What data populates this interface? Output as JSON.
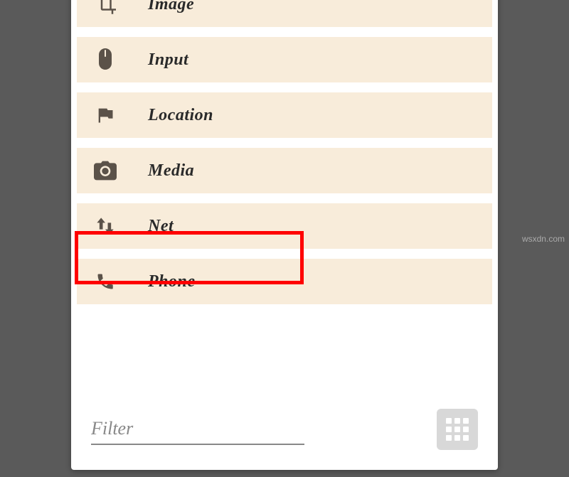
{
  "list": {
    "items": [
      {
        "icon": "crop-icon",
        "label": "Image"
      },
      {
        "icon": "mouse-icon",
        "label": "Input"
      },
      {
        "icon": "flag-icon",
        "label": "Location"
      },
      {
        "icon": "camera-icon",
        "label": "Media"
      },
      {
        "icon": "net-icon",
        "label": "Net",
        "highlighted": true
      },
      {
        "icon": "phone-icon",
        "label": "Phone"
      }
    ]
  },
  "footer": {
    "filter_placeholder": "Filter"
  },
  "watermark": "wsxdn.com"
}
